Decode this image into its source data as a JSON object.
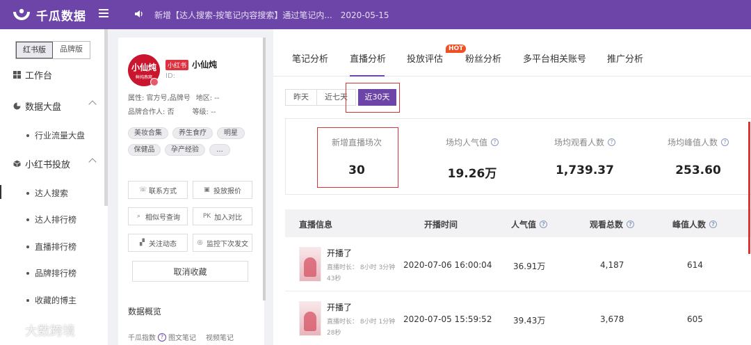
{
  "app": {
    "name": "千瓜数据"
  },
  "notice": {
    "text": "新增【达人搜索-按笔记内容搜索】通过笔记内...",
    "date": "2020-05-15"
  },
  "sidebar": {
    "version_tabs": [
      "红书版",
      "品牌版"
    ],
    "items": [
      {
        "label": "工作台",
        "icon": "grid-icon"
      },
      {
        "label": "数据大盘",
        "icon": "pie-chart-icon"
      },
      {
        "label": "行业流量大盘"
      },
      {
        "label": "小红书投放",
        "icon": "cube-icon"
      },
      {
        "label": "达人搜索"
      },
      {
        "label": "达人排行榜"
      },
      {
        "label": "直播排行榜"
      },
      {
        "label": "品牌排行榜"
      },
      {
        "label": "收藏的博主"
      }
    ]
  },
  "profile": {
    "avatar_text": "小仙炖",
    "avatar_sub": "鲜炖燕窝",
    "platform_tag": "小红书",
    "name": "小仙炖",
    "id_label": "ID:",
    "attr": "属性: 官方号,品牌号",
    "region": "地区: --",
    "brand_partner": "品牌合作人: 否",
    "level": "等级: --",
    "tags": [
      "美妆合集",
      "养生食疗",
      "明星",
      "保健品",
      "孕产经验",
      "..."
    ],
    "buttons": [
      "联系方式",
      "投放报价",
      "相似号查询",
      "加入对比",
      "关注动态",
      "监控下次发文"
    ],
    "pk_text": "PK",
    "unfollow": "取消收藏",
    "section_title": "数据概览",
    "overview": [
      "千瓜指数",
      "图文笔记",
      "视频笔记"
    ]
  },
  "main": {
    "tabs": [
      "笔记分析",
      "直播分析",
      "投放评估",
      "粉丝分析",
      "多平台相关账号",
      "推广分析"
    ],
    "hot_badge": "HOT",
    "ranges": [
      "昨天",
      "近七天",
      "近30天"
    ],
    "stats": [
      {
        "label": "新增直播场次",
        "value": "30",
        "help": false
      },
      {
        "label": "场均人气值",
        "value": "19.26万",
        "help": true
      },
      {
        "label": "场均观看人数",
        "value": "1,739.37",
        "help": true
      },
      {
        "label": "场均峰值人数",
        "value": "253.60",
        "help": true
      }
    ],
    "table": {
      "headers": [
        "直播信息",
        "开播时间",
        "人气值",
        "观看总数",
        "峰值人数"
      ],
      "rows": [
        {
          "title": "开播了",
          "duration": "直播时长： 8小时 3分钟 43秒",
          "start": "2020-07-06 16:00:04",
          "popularity": "36.91万",
          "views": "4,187",
          "peak": "614"
        },
        {
          "title": "开播了",
          "duration": "直播时长： 8小时 1分钟 28秒",
          "start": "2020-07-05 15:59:52",
          "popularity": "39.43万",
          "views": "3,678",
          "peak": "605"
        }
      ]
    }
  },
  "watermark": "大数跨境",
  "colors": {
    "brand": "#6d45a9",
    "highlight": "#d93333",
    "hot": "#f04e23"
  }
}
